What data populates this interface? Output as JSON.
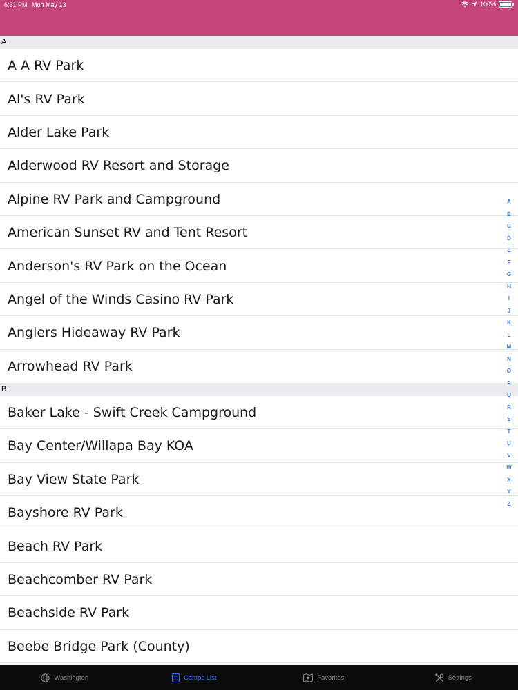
{
  "status_bar": {
    "time": "6:31 PM",
    "date": "Mon May 13",
    "battery": "100%"
  },
  "colors": {
    "header_bg": "#c4457b",
    "section_bg": "#ebebee",
    "index_color": "#2f7ce0",
    "tab_active": "#3478f6",
    "tab_inactive": "#8e8e93",
    "tab_bar_bg": "#0b0b0b"
  },
  "sections": [
    {
      "letter": "A",
      "items": [
        "A A RV Park",
        "Al's RV Park",
        "Alder Lake Park",
        "Alderwood RV Resort and Storage",
        "Alpine RV Park and Campground",
        "American Sunset RV and Tent Resort",
        "Anderson's RV Park on the Ocean",
        "Angel of the Winds Casino RV Park",
        "Anglers Hideaway RV Park",
        "Arrowhead RV Park"
      ]
    },
    {
      "letter": "B",
      "items": [
        "Baker Lake - Swift Creek Campground",
        "Bay Center/Willapa Bay KOA",
        "Bay View State Park",
        "Bayshore RV Park",
        "Beach RV Park",
        "Beachcomber RV Park",
        "Beachside RV Park",
        "Beebe Bridge Park (County)"
      ]
    }
  ],
  "index_letters": [
    "A",
    "B",
    "C",
    "D",
    "E",
    "F",
    "G",
    "H",
    "I",
    "J",
    "K",
    "L",
    "M",
    "N",
    "O",
    "P",
    "Q",
    "R",
    "S",
    "T",
    "U",
    "V",
    "W",
    "X",
    "Y",
    "Z"
  ],
  "tabs": [
    {
      "label": "Washington",
      "icon": "globe-icon",
      "active": false
    },
    {
      "label": "Camps List",
      "icon": "list-icon",
      "active": true
    },
    {
      "label": "Favorites",
      "icon": "heart-map-icon",
      "active": false
    },
    {
      "label": "Settings",
      "icon": "tools-icon",
      "active": false
    }
  ]
}
